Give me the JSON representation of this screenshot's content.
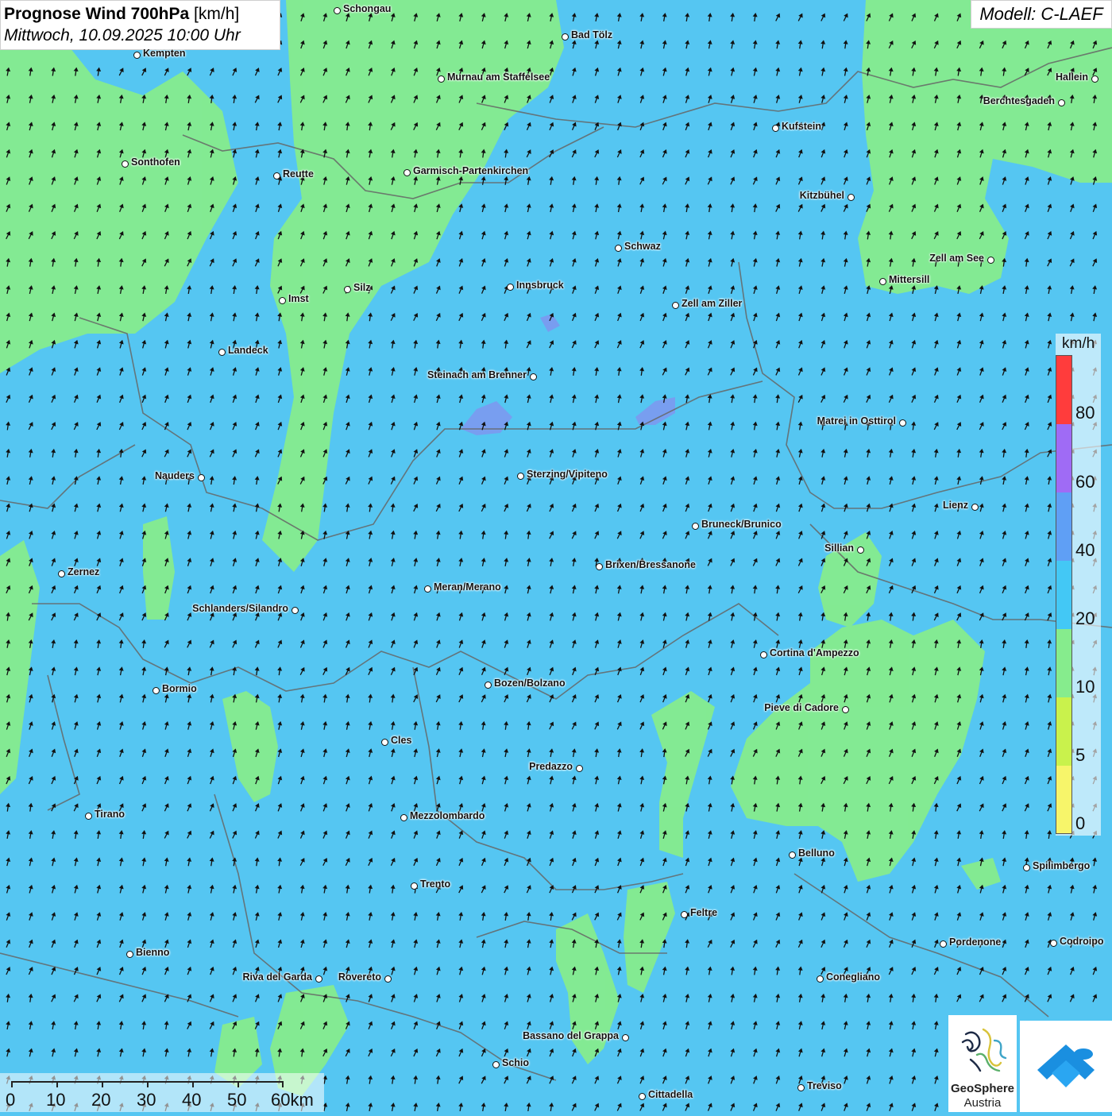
{
  "header": {
    "title_bold": "Prognose Wind 700hPa",
    "title_unit": "[km/h]",
    "subtitle": "Mittwoch, 10.09.2025 10:00 Uhr"
  },
  "model": {
    "label": "Modell: C-LAEF"
  },
  "legend": {
    "unit": "km/h",
    "labels": [
      "80",
      "60",
      "40",
      "20",
      "10",
      "5",
      "0"
    ],
    "colors": [
      "#ff3c3c",
      "#9f6bf5",
      "#5f9ff5",
      "#43c8f5",
      "#86ec8d",
      "#c9f24c",
      "#f7f56a"
    ]
  },
  "scale_bar": {
    "labels": [
      "0",
      "10",
      "20",
      "30",
      "40",
      "50",
      "60km"
    ]
  },
  "logos": {
    "geosphere_line1": "GeoSphere",
    "geosphere_line2": "Austria"
  },
  "colors": {
    "wind_10_20": "#86ec8d",
    "wind_20_40": "#55c6f2",
    "wind_40_60": "#7f97f0",
    "arrow": "#111111",
    "border": "#666666"
  },
  "map": {
    "wind_direction": "arrows point north / north-northeast",
    "cities": [
      {
        "name": "Schongau"
      },
      {
        "name": "Kempten"
      },
      {
        "name": "Bad Tölz"
      },
      {
        "name": "Murnau am Staffelsee"
      },
      {
        "name": "Hallein"
      },
      {
        "name": "Berchtesgaden"
      },
      {
        "name": "Kufstein"
      },
      {
        "name": "Sonthofen"
      },
      {
        "name": "Reutte"
      },
      {
        "name": "Garmisch-Partenkirchen"
      },
      {
        "name": "Kitzbühel"
      },
      {
        "name": "Schwaz"
      },
      {
        "name": "Zell am See"
      },
      {
        "name": "Mittersill"
      },
      {
        "name": "Innsbruck"
      },
      {
        "name": "Imst"
      },
      {
        "name": "Silz"
      },
      {
        "name": "Zell am Ziller"
      },
      {
        "name": "Landeck"
      },
      {
        "name": "Steinach am Brenner"
      },
      {
        "name": "Matrei in Osttirol"
      },
      {
        "name": "Nauders"
      },
      {
        "name": "Sterzing/Vipiteno"
      },
      {
        "name": "Lienz"
      },
      {
        "name": "Bruneck/Brunico"
      },
      {
        "name": "Sillian"
      },
      {
        "name": "Brixen/Bressanone"
      },
      {
        "name": "Zernez"
      },
      {
        "name": "Meran/Merano"
      },
      {
        "name": "Schlanders/Silandro"
      },
      {
        "name": "Cortina d'Ampezzo"
      },
      {
        "name": "Bozen/Bolzano"
      },
      {
        "name": "Bormio"
      },
      {
        "name": "Pieve di Cadore"
      },
      {
        "name": "Cles"
      },
      {
        "name": "Predazzo"
      },
      {
        "name": "Tirano"
      },
      {
        "name": "Mezzolombardo"
      },
      {
        "name": "Belluno"
      },
      {
        "name": "Spilimbergo"
      },
      {
        "name": "Trento"
      },
      {
        "name": "Feltre"
      },
      {
        "name": "Bienno"
      },
      {
        "name": "Pordenone"
      },
      {
        "name": "Codroipo"
      },
      {
        "name": "Riva del Garda"
      },
      {
        "name": "Rovereto"
      },
      {
        "name": "Conegliano"
      },
      {
        "name": "Bassano del Grappa"
      },
      {
        "name": "Schio"
      },
      {
        "name": "Treviso"
      },
      {
        "name": "Cittadella"
      }
    ]
  }
}
